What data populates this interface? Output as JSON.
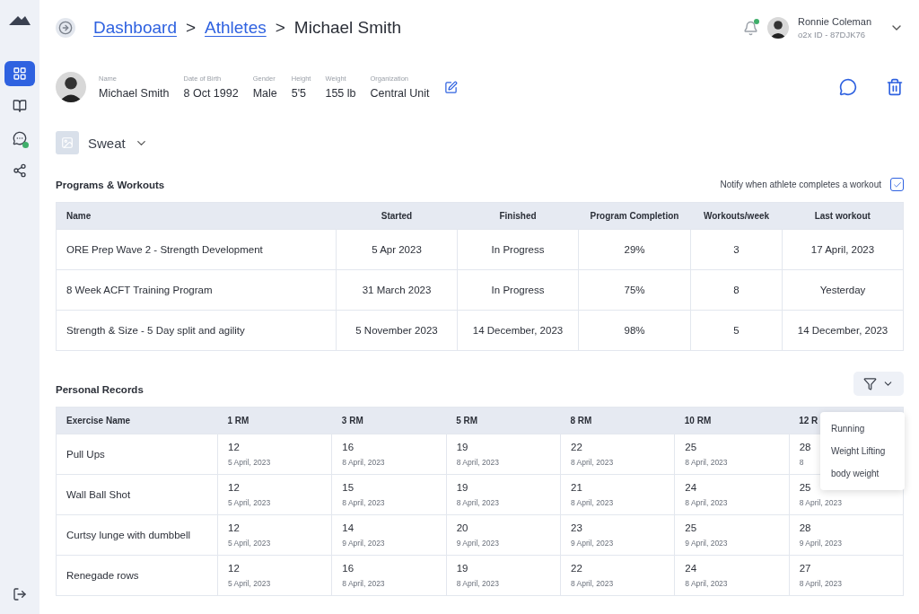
{
  "breadcrumb": [
    {
      "label": "Dashboard",
      "kind": "link"
    },
    {
      "label": ">",
      "kind": "separator"
    },
    {
      "label": "Athletes",
      "kind": "link"
    },
    {
      "label": ">",
      "kind": "separator"
    },
    {
      "label": "Michael Smith",
      "kind": "current"
    }
  ],
  "user": {
    "name": "Ronnie Coleman",
    "id": "o2x ID - 87DJK76",
    "has_notification": true
  },
  "sidebar": {
    "items": [
      {
        "selected": true
      },
      {
        "selected": false
      },
      {
        "selected": false
      },
      {
        "selected": false
      }
    ]
  },
  "profile": {
    "fields": [
      {
        "label": "Name",
        "value": "Michael Smith"
      },
      {
        "label": "Date of Birth",
        "value": "8 Oct 1992"
      },
      {
        "label": "Gender",
        "value": "Male"
      },
      {
        "label": "Height",
        "value": "5'5"
      },
      {
        "label": "Weight",
        "value": "155 lb"
      },
      {
        "label": "Organization",
        "value": "Central Unit"
      }
    ]
  },
  "team": {
    "name": "Sweat"
  },
  "programs": {
    "title": "Programs & Workouts",
    "notify": {
      "label": "Notify when athlete completes a workout",
      "checked": true
    },
    "columns": [
      "Name",
      "Started",
      "Finished",
      "Program Completion",
      "Workouts/week",
      "Last workout"
    ],
    "rows": [
      [
        "ORE Prep Wave 2 - Strength Development",
        "5 Apr 2023",
        "In Progress",
        "29%",
        "3",
        "17 April, 2023"
      ],
      [
        "8 Week ACFT Training Program",
        "31 March 2023",
        "In Progress",
        "75%",
        "8",
        "Yesterday"
      ],
      [
        "Strength & Size - 5 Day split and agility",
        "5 November 2023",
        "14 December, 2023",
        "98%",
        "5",
        "14 December, 2023"
      ]
    ]
  },
  "records": {
    "title": "Personal Records",
    "columns": [
      "Exercise Name",
      "1 RM",
      "3 RM",
      "5 RM",
      "8 RM",
      "10 RM",
      "12 R"
    ],
    "rows": [
      {
        "cells": [
          {
            "value": "Pull Ups"
          },
          {
            "value": "12",
            "date": "5 April, 2023"
          },
          {
            "value": "16",
            "date": "8 April, 2023"
          },
          {
            "value": "19",
            "date": "8 April, 2023"
          },
          {
            "value": "22",
            "date": "8 April, 2023"
          },
          {
            "value": "25",
            "date": "8 April, 2023"
          },
          {
            "value": "28",
            "date": "8"
          }
        ]
      },
      {
        "cells": [
          {
            "value": "Wall Ball Shot"
          },
          {
            "value": "12",
            "date": "5 April, 2023"
          },
          {
            "value": "15",
            "date": "8 April, 2023"
          },
          {
            "value": "19",
            "date": "8 April, 2023"
          },
          {
            "value": "21",
            "date": "8 April, 2023"
          },
          {
            "value": "24",
            "date": "8 April, 2023"
          },
          {
            "value": "25",
            "date": "8 April, 2023"
          }
        ]
      },
      {
        "cells": [
          {
            "value": "Curtsy lunge with dumbbell"
          },
          {
            "value": "12",
            "date": "5 April, 2023"
          },
          {
            "value": "14",
            "date": "9 April, 2023"
          },
          {
            "value": "20",
            "date": "9 April, 2023"
          },
          {
            "value": "23",
            "date": "9 April, 2023"
          },
          {
            "value": "25",
            "date": "9 April, 2023"
          },
          {
            "value": "28",
            "date": "9 April, 2023"
          }
        ]
      },
      {
        "cells": [
          {
            "value": "Renegade rows"
          },
          {
            "value": "12",
            "date": "5 April, 2023"
          },
          {
            "value": "16",
            "date": "8 April, 2023"
          },
          {
            "value": "19",
            "date": "8 April, 2023"
          },
          {
            "value": "22",
            "date": "8 April, 2023"
          },
          {
            "value": "24",
            "date": "8 April, 2023"
          },
          {
            "value": "27",
            "date": "8 April, 2023"
          }
        ]
      }
    ],
    "filter_menu": [
      "Running",
      "Weight Lifting",
      "body weight"
    ]
  }
}
